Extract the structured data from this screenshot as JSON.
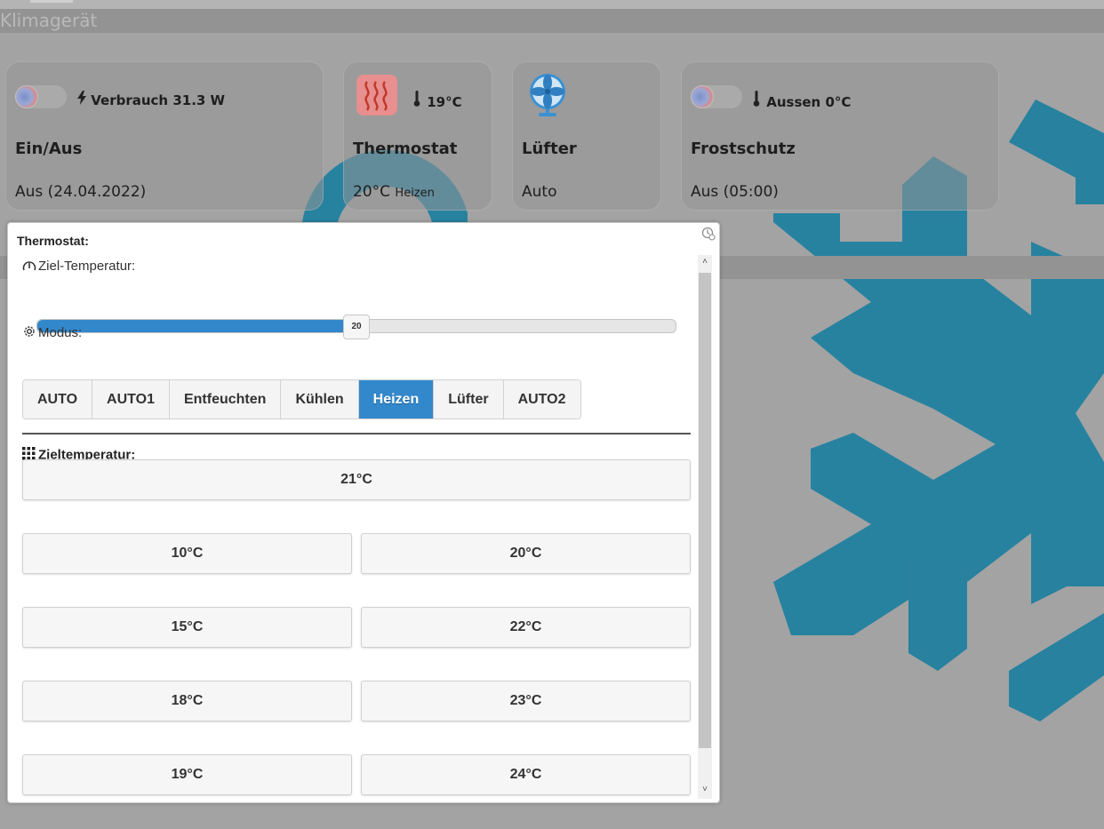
{
  "section": {
    "title": "Klimagerät"
  },
  "cards": {
    "power": {
      "meta": "Verbrauch 31.3 W",
      "title": "Ein/Aus",
      "value": "Aus (24.04.2022)"
    },
    "thermostat": {
      "meta": "19°C",
      "title": "Thermostat",
      "value": "20°C",
      "sub": "Heizen"
    },
    "fan": {
      "title": "Lüfter",
      "value": "Auto"
    },
    "frost": {
      "meta": "Aussen 0°C",
      "title": "Frostschutz",
      "value": "Aus (05:00)"
    }
  },
  "dialog": {
    "title": "Thermostat:",
    "target_label": "Ziel-Temperatur:",
    "slider": {
      "value": 20,
      "display": "20",
      "min": 10,
      "max": 30
    },
    "mode_label": "Modus:",
    "modes": [
      "AUTO",
      "AUTO1",
      "Entfeuchten",
      "Kühlen",
      "Heizen",
      "Lüfter",
      "AUTO2"
    ],
    "active_mode": "Heizen",
    "preset_label": "Zieltemperatur:",
    "presets": {
      "top": "21°C",
      "left": [
        "10°C",
        "15°C",
        "18°C",
        "19°C"
      ],
      "right": [
        "20°C",
        "22°C",
        "23°C",
        "24°C"
      ]
    }
  },
  "colors": {
    "accent": "#3388cc",
    "snowflake": "#1a7ea0",
    "heat": "#e88f8f"
  },
  "icons": [
    "bolt-icon",
    "thermometer-icon",
    "heat-icon",
    "fan-icon",
    "gauge-icon",
    "gear-icon",
    "grid-icon",
    "close-icon"
  ]
}
